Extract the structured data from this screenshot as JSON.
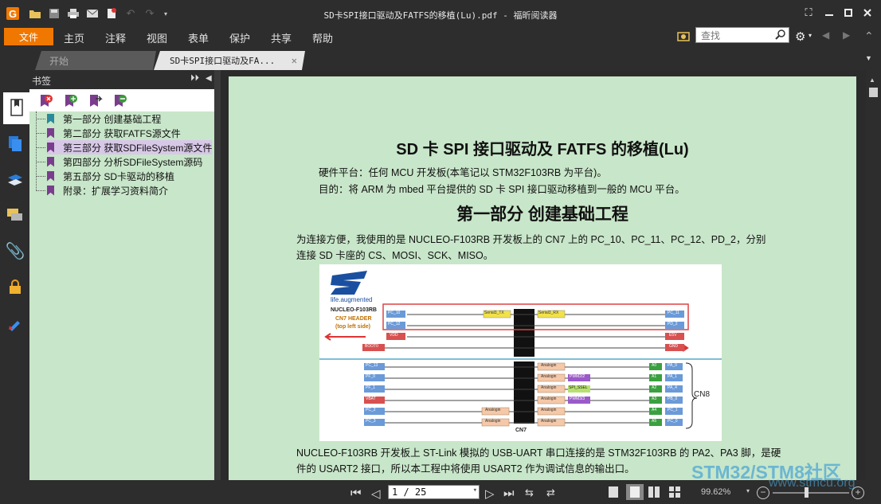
{
  "window": {
    "title": "SD卡SPI接口驱动及FATFS的移植(Lu).pdf - 福昕阅读器",
    "quick_access_icons": [
      "app-logo-icon",
      "open-folder-icon",
      "save-icon",
      "print-icon",
      "email-icon",
      "stamp-icon",
      "undo-icon",
      "redo-icon",
      "customize-icon"
    ],
    "controls": [
      "fullscreen-icon",
      "minimize-icon",
      "maximize-icon",
      "close-icon"
    ]
  },
  "menu": {
    "file": "文件",
    "items": [
      "主页",
      "注释",
      "视图",
      "表单",
      "保护",
      "共享",
      "帮助"
    ],
    "search_placeholder": "查找"
  },
  "tabs": [
    {
      "label": "开始"
    },
    {
      "label": "SD卡SPI接口驱动及FA..."
    }
  ],
  "bookmarks": {
    "title": "书签",
    "items": [
      {
        "label": "第一部分 创建基础工程"
      },
      {
        "label": "第二部分 获取FATFS源文件"
      },
      {
        "label": "第三部分 获取SDFileSystem源文件"
      },
      {
        "label": "第四部分 分析SDFileSystem源码"
      },
      {
        "label": "第五部分 SD卡驱动的移植"
      },
      {
        "label": "附录：扩展学习资料简介"
      }
    ]
  },
  "document": {
    "title": "SD 卡 SPI 接口驱动及 FATFS 的移植(Lu)",
    "hardware": "硬件平台：任何 MCU 开发板(本笔记以 STM32F103RB 为平台)。",
    "purpose": "目的：将 ARM  为 mbed 平台提供的 SD 卡 SPI 接口驱动移植到一般的 MCU 平台。",
    "section1": "第一部分  创建基础工程",
    "para1_line1": "为连接方便，我使用的是 NUCLEO-F103RB 开发板上的 CN7 上的 PC_10、PC_11、PC_12、PD_2，分别",
    "para1_line2": "连接 SD 卡座的 CS、MOSI、SCK、MISO。",
    "para2_line1": "NUCLEO-F103RB 开发板上 ST-Link 模拟的 USB-UART 串口连接的是 STM32F103RB 的 PA2、PA3 脚，是硬",
    "para2_line2": "件的 USART2 接口，所以本工程中将使用 USART2 作为调试信息的输出口。",
    "figure": {
      "tagline": "life.augmented",
      "board": "NUCLEO-F103RB",
      "header": "CN7 HEADER",
      "side": "(top left side)",
      "cn7": "CN7",
      "cn8": "CN8",
      "top_left_pins": [
        "PC_10",
        "PC_12",
        "VDD",
        "BOOT0"
      ],
      "top_right_pins": [
        "PC_11",
        "PD_2",
        "E5V",
        "GND"
      ],
      "serial_left": "Serial3_TX",
      "serial_right": "Serial3_RX",
      "bottom_left_pins": [
        "PC_13",
        "PF_0",
        "PF_1",
        "VBAT",
        "PC_2",
        "PC_3"
      ],
      "bottom_right_pins": [
        "PA_0",
        "PA_1",
        "PA_4",
        "PB_0",
        "PC_1",
        "PC_0"
      ],
      "a_pins": [
        "A0",
        "A1",
        "A2",
        "A3",
        "A4",
        "A5"
      ],
      "analog": "Analogin",
      "mid_tags": [
        "PWM2/2",
        "SPI_SSEL",
        "PWM3/3"
      ]
    }
  },
  "status": {
    "page": "1 / 25",
    "zoom": "99.62%",
    "watermark_main": "STM32/STM8社区",
    "watermark_url": "www.stmcu.org"
  }
}
